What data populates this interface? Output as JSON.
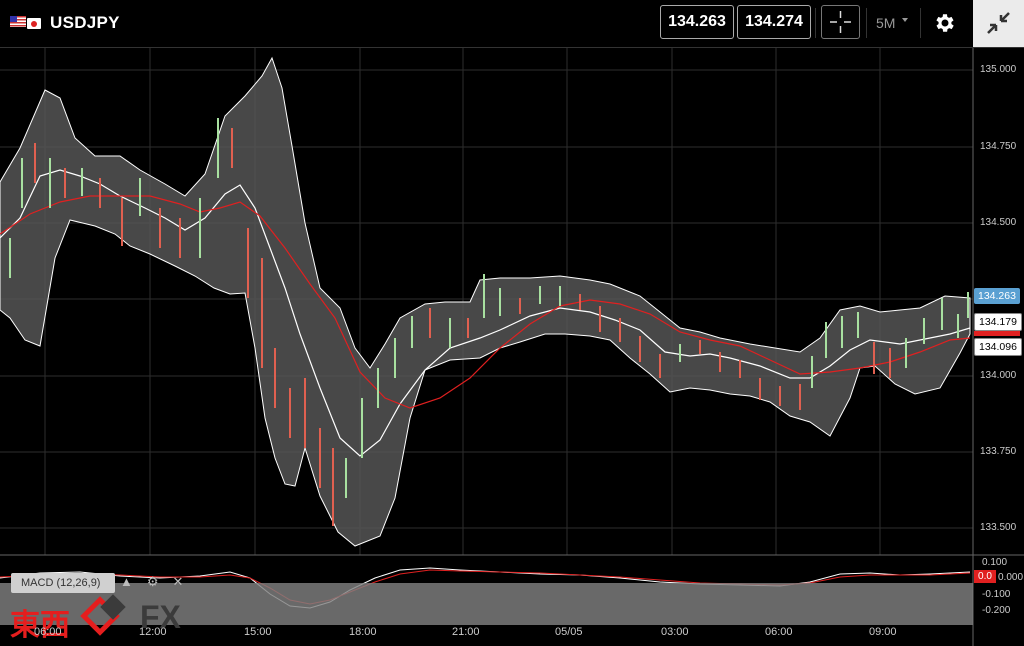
{
  "header": {
    "symbol": "USDJPY",
    "bid": "134.263",
    "ask": "134.274",
    "timeframe": "5M"
  },
  "price_axis": {
    "ticks": [
      "135.000",
      "134.750",
      "134.500",
      "134.250",
      "134.000",
      "133.750",
      "133.500"
    ],
    "current_price": "134.263",
    "upper_ma": "134.179",
    "lower_ma": "134.096"
  },
  "time_axis": [
    "06:00",
    "12:00",
    "15:00",
    "18:00",
    "21:00",
    "05/05",
    "03:00",
    "06:00",
    "09:00"
  ],
  "macd": {
    "label": "MACD (12,26,9)",
    "ticks": [
      "0.100",
      "0.000",
      "-0.100",
      "-0.200"
    ],
    "current_value": "0.0"
  },
  "watermark": {
    "brand_text": "東西",
    "fx_text": "FX"
  },
  "icons": {
    "crosshair": "crosshair-icon",
    "settings": "gear-icon",
    "fullscreen": "exit-fullscreen-icon"
  },
  "colors": {
    "ma_line": "#e02020",
    "band_line": "#ffffff",
    "candle_up": "#a8e0a0",
    "candle_down": "#e06050",
    "price_tag": "#5aa0d2"
  }
}
